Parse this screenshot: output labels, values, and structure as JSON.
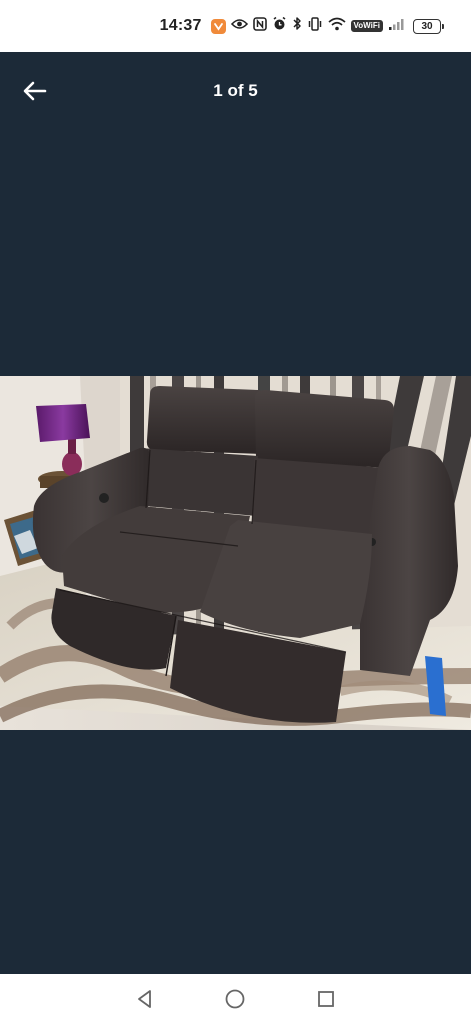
{
  "status_bar": {
    "time": "14:37",
    "vowifi_label": "VoWiFi",
    "battery_level": "30",
    "icons": [
      "app-notification-icon",
      "eye-icon",
      "nfc-icon",
      "alarm-icon",
      "bluetooth-icon",
      "vibrate-icon",
      "wifi-icon",
      "signal-icon",
      "battery-icon"
    ]
  },
  "header": {
    "back_icon": "back-arrow-icon",
    "counter": "1 of 5"
  },
  "gallery": {
    "current_index": 1,
    "total": 5,
    "photo_subject": "sofa-photo"
  },
  "colors": {
    "background": "#1c2a38",
    "status_bar": "#ffffff",
    "header_text": "#ffffff"
  },
  "nav_bar": {
    "icons": [
      "back-triangle-icon",
      "home-circle-icon",
      "recents-square-icon"
    ]
  }
}
